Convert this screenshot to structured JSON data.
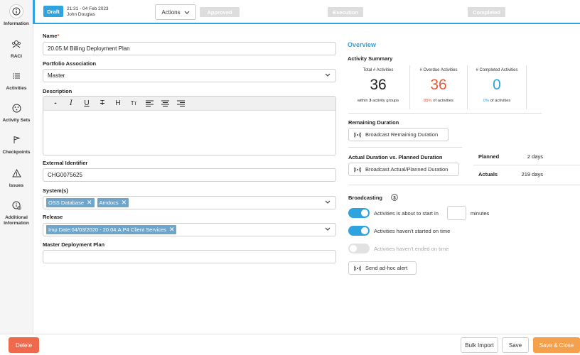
{
  "sidebar": {
    "items": [
      {
        "label": "Information",
        "icon": "info-icon"
      },
      {
        "label": "RACI",
        "icon": "people-icon"
      },
      {
        "label": "Activities",
        "icon": "list-icon"
      },
      {
        "label": "Activity Sets",
        "icon": "activity-sets-icon"
      },
      {
        "label": "Checkpoints",
        "icon": "flag-icon"
      },
      {
        "label": "Issues",
        "icon": "warning-icon"
      },
      {
        "label": "Additional",
        "label2": "Information",
        "icon": "additional-info-icon"
      }
    ]
  },
  "header": {
    "status": "Draft",
    "datetime": "21:31 - 04 Feb 2023",
    "user": "John Douglas",
    "actions_label": "Actions",
    "stages": [
      "Approved",
      "Execution",
      "Completed"
    ]
  },
  "form": {
    "name_label": "Name",
    "name_required": "*",
    "name_value": "20.05.M Billing Deployment Plan",
    "portfolio_label": "Portfolio Association",
    "portfolio_value": "Master",
    "description_label": "Description",
    "toolbar": [
      "-",
      "I",
      "U",
      "T",
      "H",
      "Tт",
      "align-left",
      "align-center",
      "align-right"
    ],
    "external_id_label": "External Identifier",
    "external_id_value": "CHG0075625",
    "systems_label": "System(s)",
    "systems_tags": [
      "OSS Database",
      "Amdocs"
    ],
    "release_label": "Release",
    "release_tags": [
      "Imp Date:04/03/2020 - 20.04.A.P4 Client Services"
    ],
    "master_plan_label": "Master Deployment Plan",
    "master_plan_value": ""
  },
  "overview": {
    "title": "Overview",
    "activity_summary_title": "Activity Summary",
    "total": {
      "label": "Total # Activities",
      "value": "36",
      "sub_prefix": "within ",
      "sub_bold": "3",
      "sub_suffix": " activity groups"
    },
    "overdue": {
      "label": "# Overdue Activities",
      "value": "36",
      "sub_pct": "88%",
      "sub_suffix": " of activities",
      "color": "#e85a3f"
    },
    "completed": {
      "label": "# Completed Activities",
      "value": "0",
      "sub_pct": "0%",
      "sub_suffix": " of activities",
      "color": "#2ea3dd"
    },
    "remaining_title": "Remaining Duration",
    "broadcast_remaining": "Broadcast Remaining Duration",
    "actual_vs_planned_title": "Actual Duration vs. Planned Duration",
    "broadcast_actual": "Broadcast Actual/Planned Duration",
    "planned_label": "Planned",
    "planned_value": "2 days",
    "actuals_label": "Actuals",
    "actuals_value": "219 days",
    "broadcasting_title": "Broadcasting",
    "toggle_start_label": "Activities is about to start in",
    "toggle_start_unit": "minutes",
    "toggle_start_on": true,
    "toggle_not_started_label": "Activities haven't started on time",
    "toggle_not_started_on": true,
    "toggle_not_ended_label": "Activities haven't ended on time",
    "toggle_not_ended_on": false,
    "send_alert_label": "Send ad-hoc alert"
  },
  "footer": {
    "delete_label": "Delete",
    "bulk_import_label": "Bulk Import",
    "save_label": "Save",
    "save_close_label": "Save & Close"
  },
  "colors": {
    "accent": "#2ea3dd",
    "danger": "#ef6a4d",
    "warning": "#f5a04b"
  }
}
